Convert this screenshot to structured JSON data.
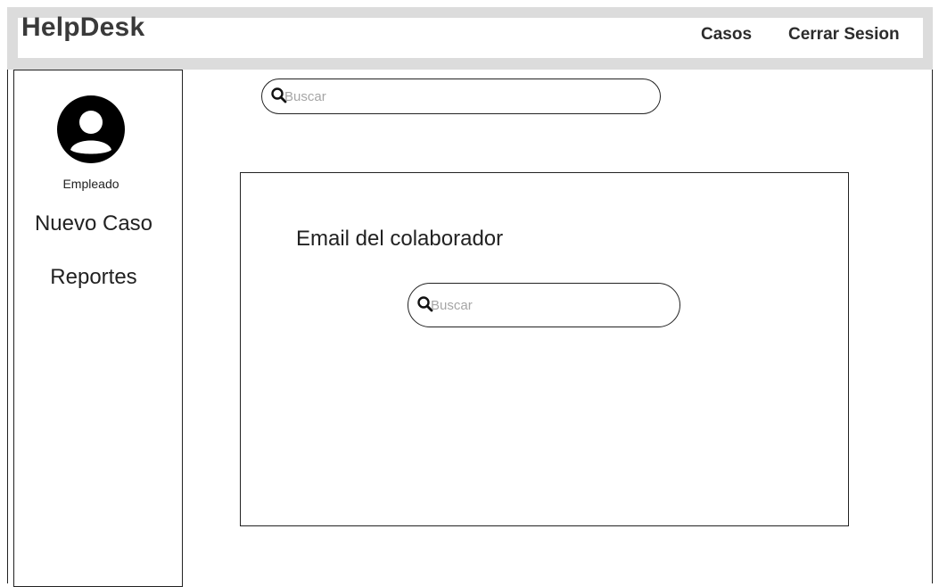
{
  "header": {
    "brand": "HelpDesk",
    "nav": {
      "casos": "Casos",
      "logout": "Cerrar Sesion"
    }
  },
  "sidebar": {
    "avatar_icon": "user-circle-icon",
    "avatar_label": "Empleado",
    "items": [
      {
        "label": "Nuevo Caso"
      },
      {
        "label": "Reportes"
      }
    ]
  },
  "search": {
    "icon": "search-icon",
    "placeholder": "Buscar",
    "value": ""
  },
  "panel": {
    "title": "Email del colaborador",
    "search": {
      "icon": "search-icon",
      "placeholder": "Buscar",
      "value": ""
    }
  },
  "colors": {
    "header_band": "#dcdcdc",
    "text": "#222222",
    "brand": "#3a3a3a",
    "placeholder": "#a6a6a6"
  }
}
